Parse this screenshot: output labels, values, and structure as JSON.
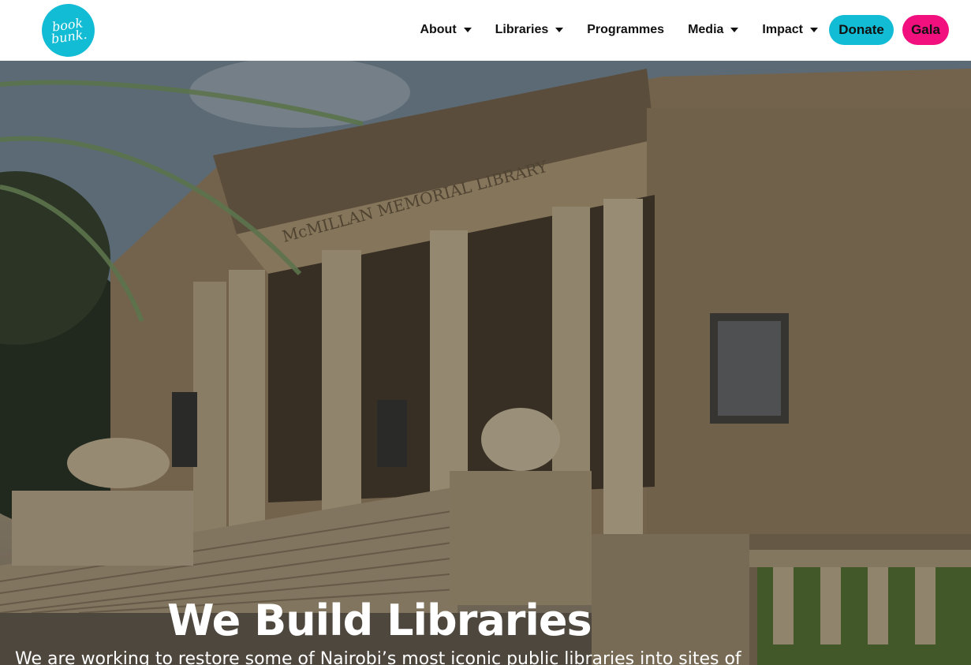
{
  "header": {
    "logo_line1": "book",
    "logo_line2": "bunk.",
    "nav": [
      {
        "label": "About",
        "dropdown": true
      },
      {
        "label": "Libraries",
        "dropdown": true
      },
      {
        "label": "Programmes",
        "dropdown": false
      },
      {
        "label": "Media",
        "dropdown": true
      },
      {
        "label": "Impact",
        "dropdown": true
      }
    ],
    "donate_label": "Donate",
    "gala_label": "Gala"
  },
  "hero": {
    "building_inscription": "McMILLAN MEMORIAL LIBRARY",
    "title": "We Build Libraries",
    "subtitle": "We are working to restore some of Nairobi’s most iconic public libraries into sites of"
  },
  "colors": {
    "brand_teal": "#12bcd4",
    "gala_pink": "#f2107f",
    "header_bg": "#ffffff"
  },
  "icons": {
    "dropdown": "chevron-down-icon"
  }
}
